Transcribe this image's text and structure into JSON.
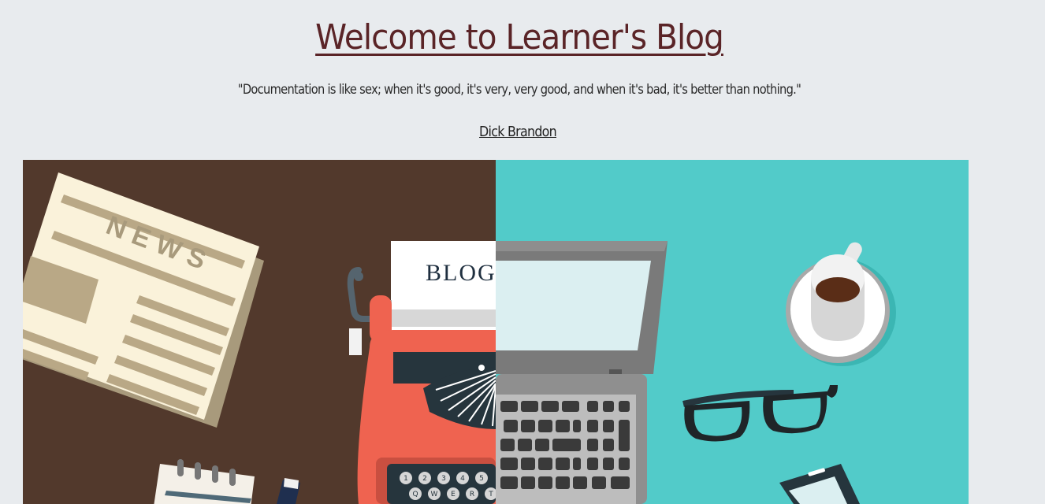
{
  "header": {
    "title": "Welcome to Learner's Blog",
    "quote": "\"Documentation is like sex; when it's good, it's very, very good, and when it's bad, it's better than nothing.\"",
    "author": "Dick Brandon"
  },
  "hero": {
    "newspaper_text": "NEWS",
    "typewriter_paper_text": "BLOG",
    "typewriter_number_keys": [
      "1",
      "2",
      "3",
      "4",
      "5"
    ],
    "typewriter_letter_keys": [
      "Q",
      "W",
      "E",
      "R",
      "T"
    ],
    "colors": {
      "left_background": "#52392c",
      "right_background": "#52cbc9",
      "typewriter": "#ef6350",
      "newspaper": "#faf2da",
      "laptop": "#8a8a8a"
    }
  }
}
